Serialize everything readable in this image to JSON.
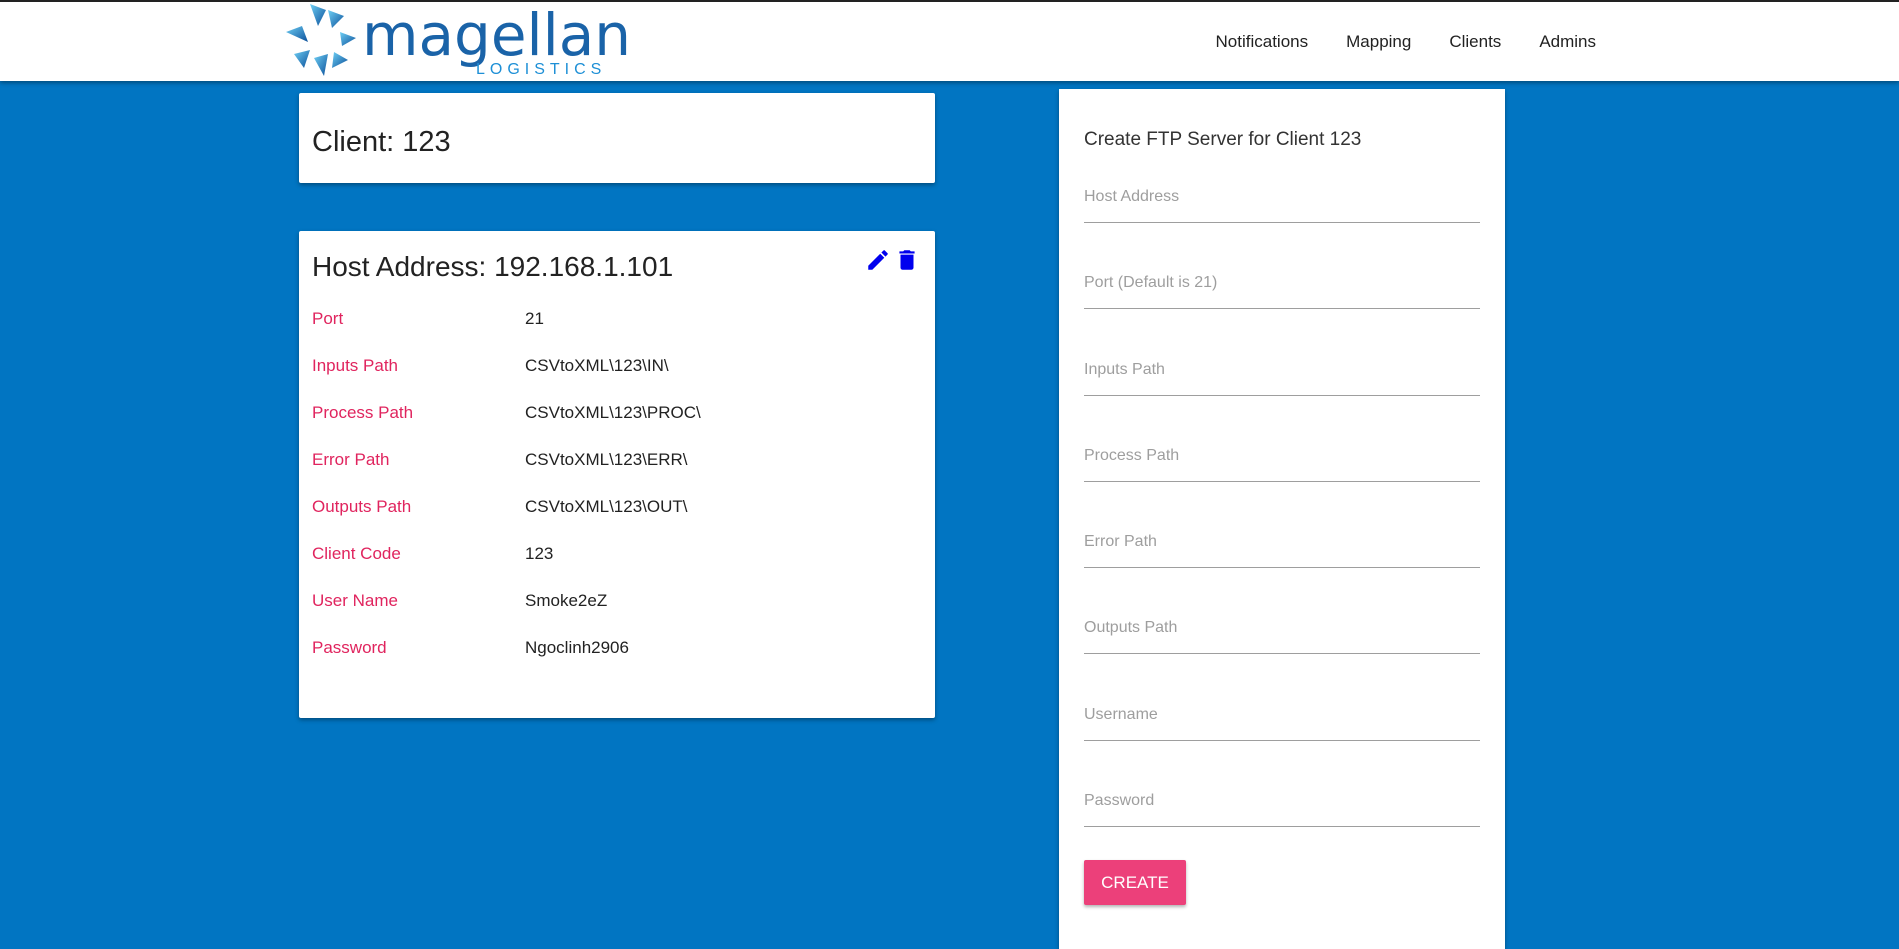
{
  "header": {
    "logo_word": "magellan",
    "logo_sub": "LOGISTICS",
    "nav": [
      "Notifications",
      "Mapping",
      "Clients",
      "Admins"
    ]
  },
  "client": {
    "title": "Client: 123"
  },
  "host": {
    "title": "Host Address: 192.168.1.101",
    "edit_icon": "pencil-icon",
    "delete_icon": "trash-icon",
    "rows": [
      {
        "label": "Port",
        "value": "21"
      },
      {
        "label": "Inputs Path",
        "value": "CSVtoXML\\123\\IN\\"
      },
      {
        "label": "Process Path",
        "value": "CSVtoXML\\123\\PROC\\"
      },
      {
        "label": "Error Path",
        "value": "CSVtoXML\\123\\ERR\\"
      },
      {
        "label": "Outputs Path",
        "value": "CSVtoXML\\123\\OUT\\"
      },
      {
        "label": "Client Code",
        "value": "123"
      },
      {
        "label": "User Name",
        "value": "Smoke2eZ"
      },
      {
        "label": "Password",
        "value": "Ngoclinh2906"
      }
    ]
  },
  "form": {
    "title": "Create FTP Server for Client 123",
    "fields": [
      {
        "placeholder": "Host Address",
        "value": ""
      },
      {
        "placeholder": "Port (Default is 21)",
        "value": ""
      },
      {
        "placeholder": "Inputs Path",
        "value": ""
      },
      {
        "placeholder": "Process Path",
        "value": ""
      },
      {
        "placeholder": "Error Path",
        "value": ""
      },
      {
        "placeholder": "Outputs Path",
        "value": ""
      },
      {
        "placeholder": "Username",
        "value": ""
      },
      {
        "placeholder": "Password",
        "value": ""
      }
    ],
    "create_label": "CREATE"
  },
  "colors": {
    "background": "#0175c2",
    "label_accent": "#e0245e",
    "button": "#ec407a",
    "icon": "#0000ee"
  }
}
